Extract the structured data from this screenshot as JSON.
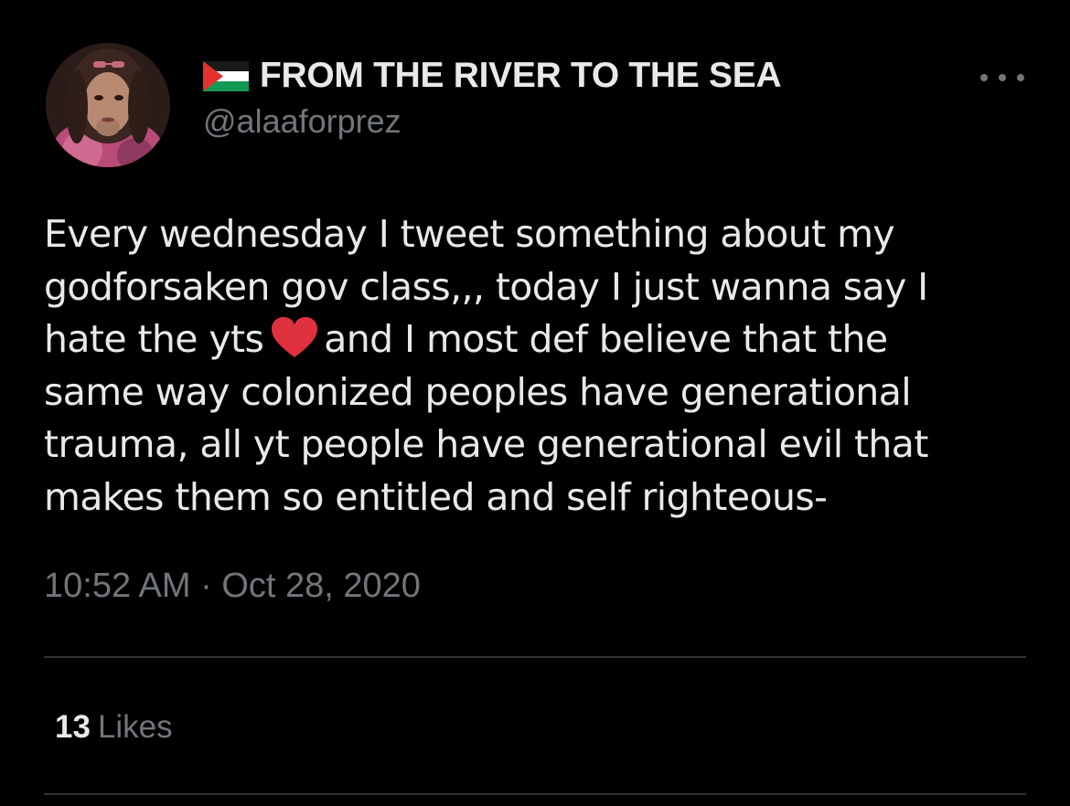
{
  "author": {
    "display_name": "FROM THE RIVER TO THE SEA",
    "handle": "@alaaforprez",
    "flag_icon": "palestine-flag-icon",
    "avatar_icon": "profile-photo"
  },
  "tweet": {
    "lines": [
      [
        "Every wednesday I tweet something about my"
      ],
      [
        "godforsaken gov class,,, today I just wanna say I"
      ],
      [
        "hate the yts",
        "and I most def believe that the"
      ],
      [
        "same way colonized peoples have generational"
      ],
      [
        "trauma, all yt people have generational evil that"
      ],
      [
        "makes them so entitled and self righteous-"
      ]
    ],
    "emoji": "red-heart-icon",
    "time": "10:52 AM",
    "separator": "·",
    "date": "Oct 28, 2020"
  },
  "stats": {
    "likes_count": "13",
    "likes_label": "Likes"
  },
  "colors": {
    "background": "#000000",
    "text_primary": "#e7e9ea",
    "text_secondary": "#71767b",
    "divider": "#2f3336",
    "heart": "#e0313e",
    "flag_red": "#e4312b",
    "flag_green": "#149954"
  }
}
